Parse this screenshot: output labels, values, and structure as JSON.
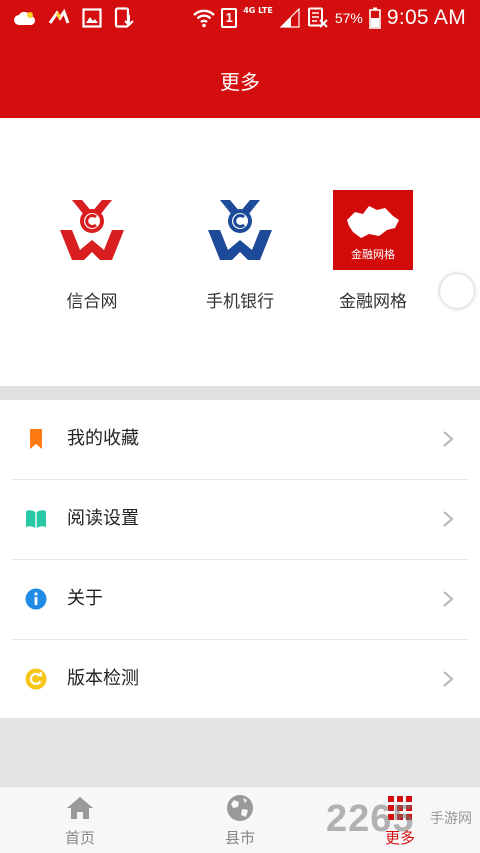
{
  "status_bar": {
    "battery_percent": "57%",
    "time": "9:05 AM",
    "network": "4G LTE",
    "sim": "1"
  },
  "header": {
    "title": "更多"
  },
  "shortcuts": [
    {
      "label": "信合网",
      "icon": "bank-logo-red",
      "color": "#d81e1e"
    },
    {
      "label": "手机银行",
      "icon": "bank-logo-blue",
      "color": "#1e4a9a"
    },
    {
      "label": "金融网格",
      "icon": "hubei-map-logo",
      "color": "#d20a0a",
      "logo_text": "金融网格"
    }
  ],
  "menu": [
    {
      "label": "我的收藏",
      "icon": "bookmark-icon",
      "color": "#ff7a12"
    },
    {
      "label": "阅读设置",
      "icon": "book-icon",
      "color": "#26c9a3"
    },
    {
      "label": "关于",
      "icon": "info-icon",
      "color": "#1f8be6"
    },
    {
      "label": "版本检测",
      "icon": "update-icon",
      "color": "#f5c518"
    }
  ],
  "bottom_nav": [
    {
      "label": "首页",
      "icon": "home-icon",
      "active": false
    },
    {
      "label": "县市",
      "icon": "globe-icon",
      "active": false
    },
    {
      "label": "更多",
      "icon": "grid-icon",
      "active": true
    }
  ],
  "watermark": {
    "number": "2265",
    "text": "手游网"
  },
  "colors": {
    "brand_red": "#d40e0e",
    "inactive": "#888888"
  }
}
